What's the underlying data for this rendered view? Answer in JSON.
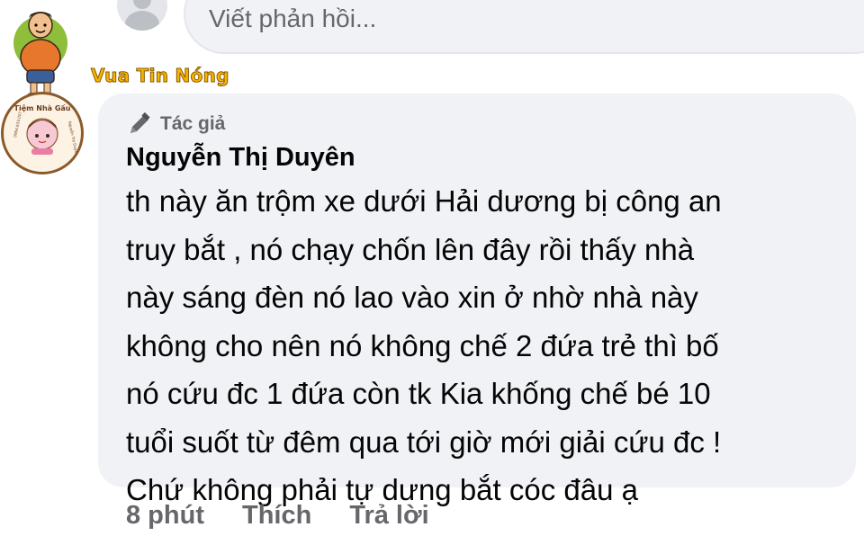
{
  "reply_composer": {
    "placeholder": "Viết phản hồi..."
  },
  "watermark": {
    "name": "Vua Tin Nóng"
  },
  "comment": {
    "author_badge": "Tác giả",
    "author_name": "Nguyễn Thị Duyên",
    "avatar_text": {
      "shop": "Tiệm Nhà Gấu",
      "phone": "0964.633.007",
      "owner": "Nguyễn Thị Duyên"
    },
    "lines": [
      "th này ăn trộm xe dưới Hải dương bị công an",
      "truy bắt , nó chạy chốn lên đây rồi thấy nhà",
      "này sáng đèn nó lao vào xin ở nhờ nhà này",
      "không cho nên  nó  không chế 2 đứa trẻ thì bố",
      "nó cứu đc 1 đứa còn tk Kia khống chế bé 10",
      "tuổi suốt từ đêm qua tới giờ mới giải cứu đc !",
      "Chứ không phải tự dưng bắt cóc đâu ạ"
    ],
    "time": "8 phút",
    "like_label": "Thích",
    "reply_label": "Trả lời"
  },
  "colors": {
    "bubble": "#f0f2f5",
    "secondary_text": "#65676b",
    "watermark": "#f7b500"
  }
}
